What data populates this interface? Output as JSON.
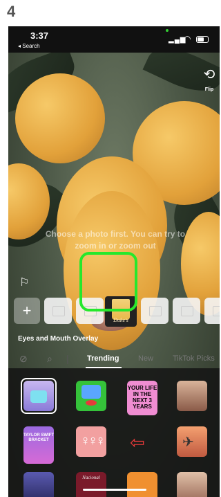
{
  "step_number": "4",
  "status_bar": {
    "time": "3:37",
    "back_label": "◂ Search"
  },
  "camera": {
    "flip_label": "Flip",
    "hint_text": "Choose a photo first. You can try to zoom in or zoom out"
  },
  "tray": {
    "plus_label": "+",
    "selected_thumb_text": "Duke's"
  },
  "effect": {
    "name": "Eyes and Mouth Overlay"
  },
  "tabs": {
    "items": [
      "Trending",
      "New",
      "TikTok Picks"
    ],
    "active": "Trending"
  },
  "effects_grid": {
    "yearly_text": "YOUR LIFE IN THE NEXT 3 YEARS",
    "taylor_text": "TAYLOR SWIFT BRACKET",
    "bottom_text": "Nacional"
  },
  "colors": {
    "highlight": "#26e82c",
    "accent_red": "#e63a3a",
    "tile_pink": "#f08dd2"
  }
}
